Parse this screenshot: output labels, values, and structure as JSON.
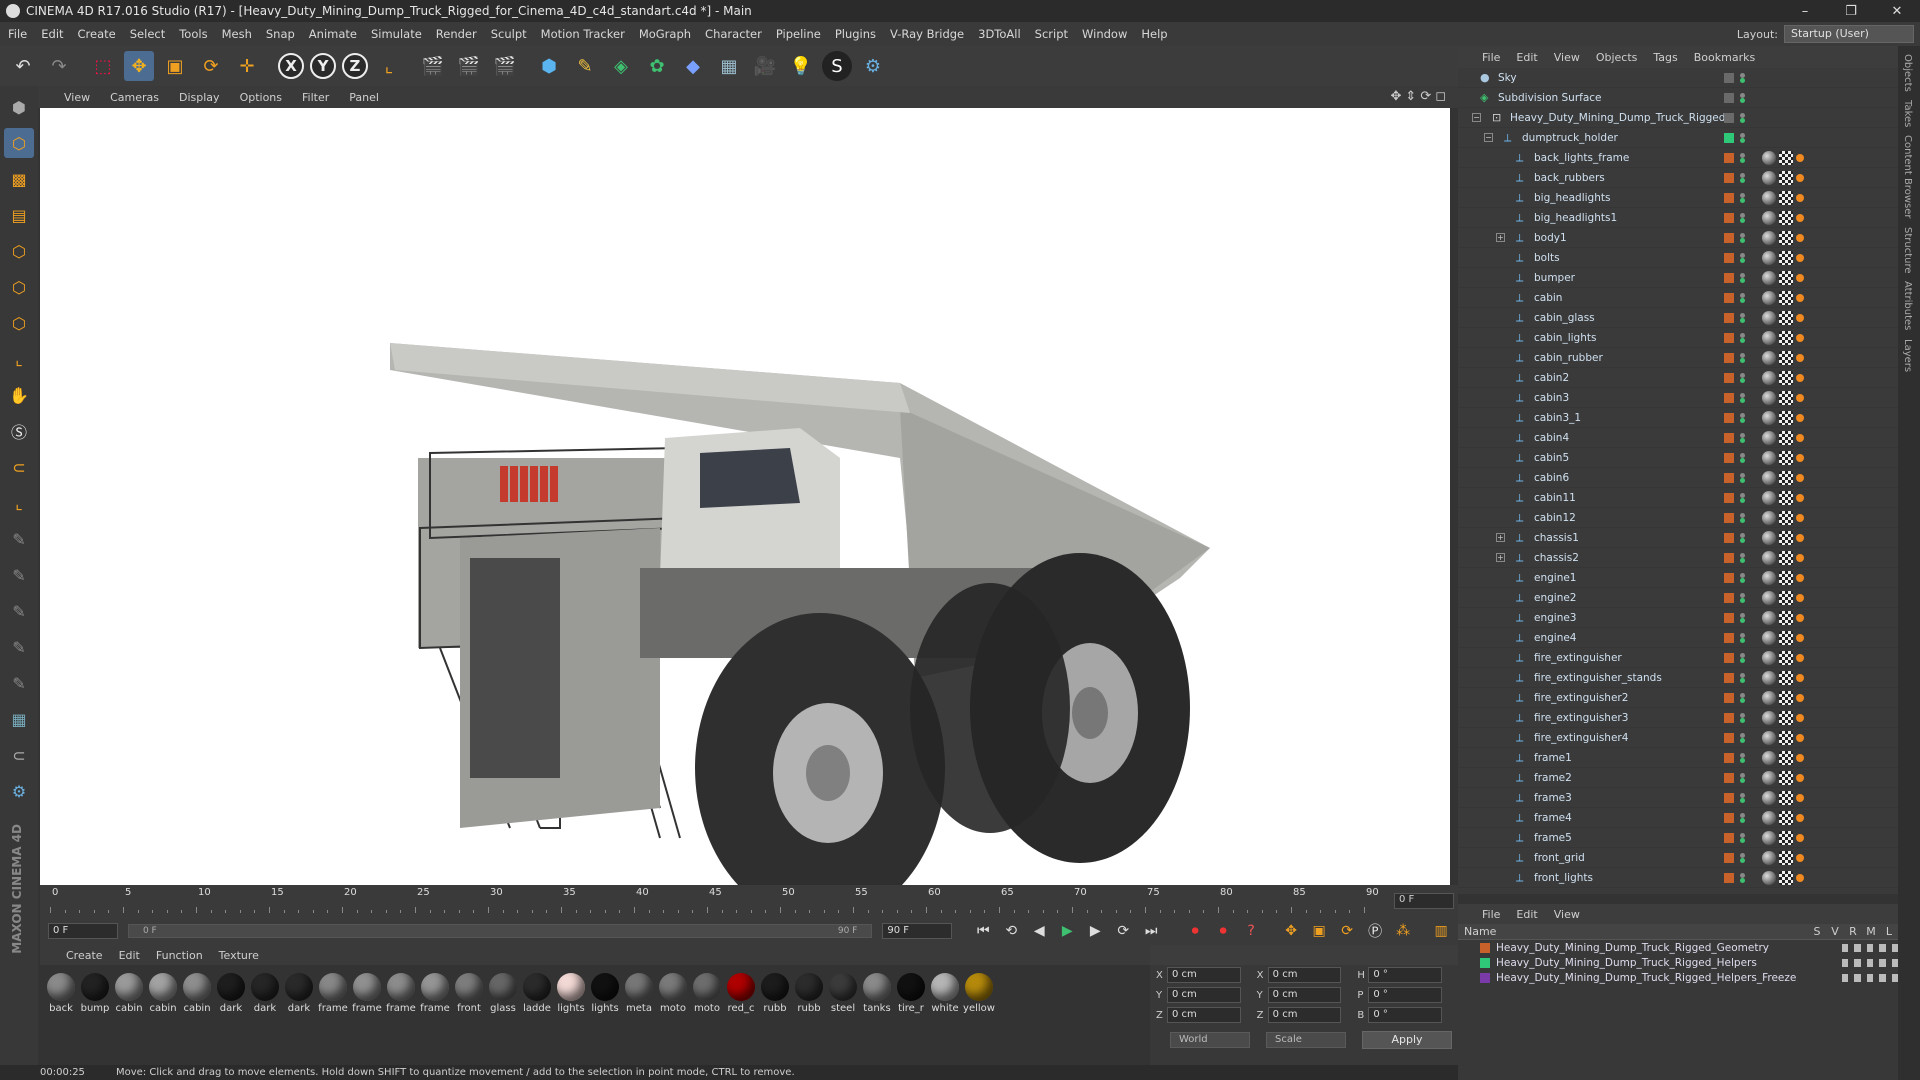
{
  "window": {
    "title": "CINEMA 4D R17.016 Studio (R17) - [Heavy_Duty_Mining_Dump_Truck_Rigged_for_Cinema_4D_c4d_standart.c4d *] - Main",
    "controls": [
      "–",
      "❐",
      "✕"
    ]
  },
  "menubar": [
    "File",
    "Edit",
    "Create",
    "Select",
    "Tools",
    "Mesh",
    "Snap",
    "Animate",
    "Simulate",
    "Render",
    "Sculpt",
    "Motion Tracker",
    "MoGraph",
    "Character",
    "Pipeline",
    "Plugins",
    "V-Ray Bridge",
    "3DToAll",
    "Script",
    "Window",
    "Help"
  ],
  "layout": {
    "label": "Layout:",
    "value": "Startup (User)"
  },
  "toolbar": {
    "axes": [
      "X",
      "Y",
      "Z"
    ]
  },
  "viewport": {
    "menu": [
      "View",
      "Cameras",
      "Display",
      "Options",
      "Filter",
      "Panel"
    ]
  },
  "timeline": {
    "ticks": [
      "0",
      "5",
      "10",
      "15",
      "20",
      "25",
      "30",
      "35",
      "40",
      "45",
      "50",
      "55",
      "60",
      "65",
      "70",
      "75",
      "80",
      "85",
      "90"
    ],
    "current": "0 F"
  },
  "transport": {
    "start": "0 F",
    "range_start": "0 F",
    "range_end": "90 F",
    "end": "90 F"
  },
  "materials": {
    "menu": [
      "Create",
      "Edit",
      "Function",
      "Texture"
    ],
    "items": [
      {
        "name": "back",
        "color": "#8a8a8a"
      },
      {
        "name": "bump",
        "color": "#222"
      },
      {
        "name": "cabin",
        "color": "#9a9a9a"
      },
      {
        "name": "cabin",
        "color": "#a2a2a2"
      },
      {
        "name": "cabin",
        "color": "#8e8e8e"
      },
      {
        "name": "dark",
        "color": "#1e1e1e"
      },
      {
        "name": "dark",
        "color": "#262626"
      },
      {
        "name": "dark",
        "color": "#2a2a2a"
      },
      {
        "name": "frame",
        "color": "#888"
      },
      {
        "name": "frame",
        "color": "#909090"
      },
      {
        "name": "frame",
        "color": "#8c8c8c"
      },
      {
        "name": "frame",
        "color": "#959595"
      },
      {
        "name": "front",
        "color": "#7d7d7d"
      },
      {
        "name": "glass",
        "color": "#666"
      },
      {
        "name": "ladde",
        "color": "#2b2b2b"
      },
      {
        "name": "lights",
        "color": "#f3d9d6"
      },
      {
        "name": "lights",
        "color": "#111"
      },
      {
        "name": "meta",
        "color": "#777"
      },
      {
        "name": "moto",
        "color": "#7a7a7a"
      },
      {
        "name": "moto",
        "color": "#6d6d6d"
      },
      {
        "name": "red_c",
        "color": "#b00000"
      },
      {
        "name": "rubb",
        "color": "#1c1c1c"
      },
      {
        "name": "rubb",
        "color": "#2c2c2c"
      },
      {
        "name": "steel",
        "color": "#3b3b3b"
      },
      {
        "name": "tanks",
        "color": "#8a8a8a"
      },
      {
        "name": "tire_r",
        "color": "#111"
      },
      {
        "name": "white",
        "color": "#b5b5b5"
      },
      {
        "name": "yellow",
        "color": "#b58a0c"
      }
    ]
  },
  "coords": {
    "rows": [
      {
        "a": "X",
        "v1": "0 cm",
        "b": "X",
        "v2": "0 cm",
        "c": "H",
        "v3": "0 °"
      },
      {
        "a": "Y",
        "v1": "0 cm",
        "b": "Y",
        "v2": "0 cm",
        "c": "P",
        "v3": "0 °"
      },
      {
        "a": "Z",
        "v1": "0 cm",
        "b": "Z",
        "v2": "0 cm",
        "c": "B",
        "v3": "0 °"
      }
    ],
    "mode": "World",
    "scale": "Scale",
    "apply": "Apply"
  },
  "status": {
    "time": "00:00:25",
    "message": "Move: Click and drag to move elements. Hold down SHIFT to quantize movement / add to the selection in point mode, CTRL to remove."
  },
  "objects": {
    "menu": [
      "File",
      "Edit",
      "View",
      "Objects",
      "Tags",
      "Bookmarks"
    ],
    "rows": [
      {
        "name": "Sky",
        "level": 0,
        "icon": "sky"
      },
      {
        "name": "Subdivision Surface",
        "level": 0,
        "icon": "sds"
      },
      {
        "name": "Heavy_Duty_Mining_Dump_Truck_Rigged",
        "level": 1,
        "icon": "null"
      },
      {
        "name": "dumptruck_holder",
        "level": 2,
        "icon": "bone"
      },
      {
        "name": "back_lights_frame",
        "level": 3
      },
      {
        "name": "back_rubbers",
        "level": 3
      },
      {
        "name": "big_headlights",
        "level": 3
      },
      {
        "name": "big_headlights1",
        "level": 3
      },
      {
        "name": "body1",
        "level": 3,
        "exp": true
      },
      {
        "name": "bolts",
        "level": 3
      },
      {
        "name": "bumper",
        "level": 3
      },
      {
        "name": "cabin",
        "level": 3
      },
      {
        "name": "cabin_glass",
        "level": 3
      },
      {
        "name": "cabin_lights",
        "level": 3
      },
      {
        "name": "cabin_rubber",
        "level": 3
      },
      {
        "name": "cabin2",
        "level": 3
      },
      {
        "name": "cabin3",
        "level": 3
      },
      {
        "name": "cabin3_1",
        "level": 3
      },
      {
        "name": "cabin4",
        "level": 3
      },
      {
        "name": "cabin5",
        "level": 3
      },
      {
        "name": "cabin6",
        "level": 3
      },
      {
        "name": "cabin11",
        "level": 3
      },
      {
        "name": "cabin12",
        "level": 3
      },
      {
        "name": "chassis1",
        "level": 3,
        "exp": true
      },
      {
        "name": "chassis2",
        "level": 3,
        "exp": true
      },
      {
        "name": "engine1",
        "level": 3
      },
      {
        "name": "engine2",
        "level": 3
      },
      {
        "name": "engine3",
        "level": 3
      },
      {
        "name": "engine4",
        "level": 3
      },
      {
        "name": "fire_extinguisher",
        "level": 3
      },
      {
        "name": "fire_extinguisher_stands",
        "level": 3
      },
      {
        "name": "fire_extinguisher2",
        "level": 3
      },
      {
        "name": "fire_extinguisher3",
        "level": 3
      },
      {
        "name": "fire_extinguisher4",
        "level": 3
      },
      {
        "name": "frame1",
        "level": 3
      },
      {
        "name": "frame2",
        "level": 3
      },
      {
        "name": "frame3",
        "level": 3
      },
      {
        "name": "frame4",
        "level": 3
      },
      {
        "name": "frame5",
        "level": 3
      },
      {
        "name": "front_grid",
        "level": 3
      },
      {
        "name": "front_lights",
        "level": 3
      }
    ]
  },
  "layers": {
    "menu": [
      "File",
      "Edit",
      "View"
    ],
    "header": {
      "name": "Name",
      "cols": [
        "S",
        "V",
        "R",
        "M",
        "L"
      ]
    },
    "rows": [
      {
        "name": "Heavy_Duty_Mining_Dump_Truck_Rigged_Geometry",
        "color": "#c8622a"
      },
      {
        "name": "Heavy_Duty_Mining_Dump_Truck_Rigged_Helpers",
        "color": "#2ec878"
      },
      {
        "name": "Heavy_Duty_Mining_Dump_Truck_Rigged_Helpers_Freeze",
        "color": "#7a3aa8"
      }
    ]
  },
  "sidetabs": [
    "Objects",
    "Takes",
    "Content Browser",
    "Structure",
    "Attributes",
    "Layers"
  ]
}
